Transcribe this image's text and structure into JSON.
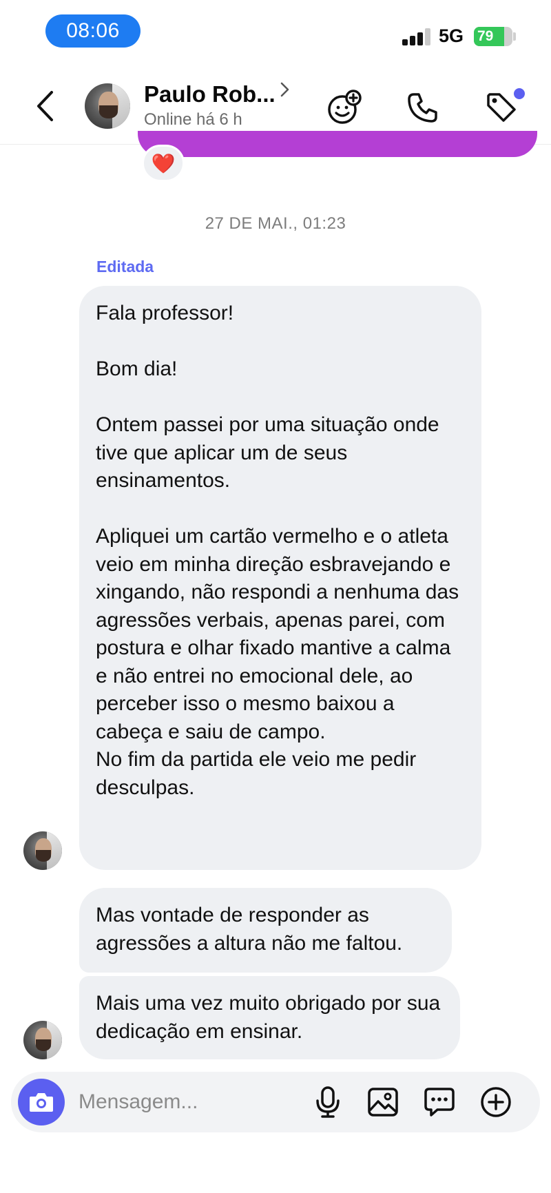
{
  "status_bar": {
    "time": "08:06",
    "network": "5G",
    "battery": "79",
    "battery_level": 0.79
  },
  "header": {
    "contact_name": "Paulo Rob...",
    "contact_status": "Online há 6 h"
  },
  "icons": {
    "back": "chevron-left-icon",
    "name_chevron": "chevron-right-icon",
    "sticker": "smile-plus-icon",
    "call": "phone-icon",
    "tag": "tag-icon",
    "camera": "camera-icon",
    "mic": "microphone-icon",
    "image": "image-icon",
    "message": "message-dots-icon",
    "more": "plus-circle-icon"
  },
  "chat": {
    "reaction": "❤️",
    "date_divider": "27 DE MAI., 01:23",
    "edited_label": "Editada",
    "messages": [
      {
        "text": "Fala professor!\n\nBom dia!\n\nOntem passei por uma situação onde tive que aplicar um de seus ensinamentos.\n\nApliquei um cartão vermelho e o atleta veio em minha direção esbravejando e xingando, não respondi a nenhuma das agressões verbais, apenas parei, com postura e olhar fixado mantive a calma e não entrei no emocional dele, ao perceber isso o mesmo baixou a cabeça e saiu de campo.\nNo fim da partida ele veio me pedir desculpas."
      },
      {
        "text": "Mas vontade de responder as agressões a altura não me faltou."
      },
      {
        "text": "Mais uma vez muito obrigado por sua dedicação em ensinar."
      }
    ]
  },
  "composer": {
    "placeholder": "Mensagem..."
  },
  "colors": {
    "time_pill": "#1e7cf2",
    "accent": "#5b5ff0",
    "prev_bubble": "#b43fd4",
    "bubble": "#eef0f3",
    "battery": "#34c759",
    "edited": "#5e6bf2"
  }
}
